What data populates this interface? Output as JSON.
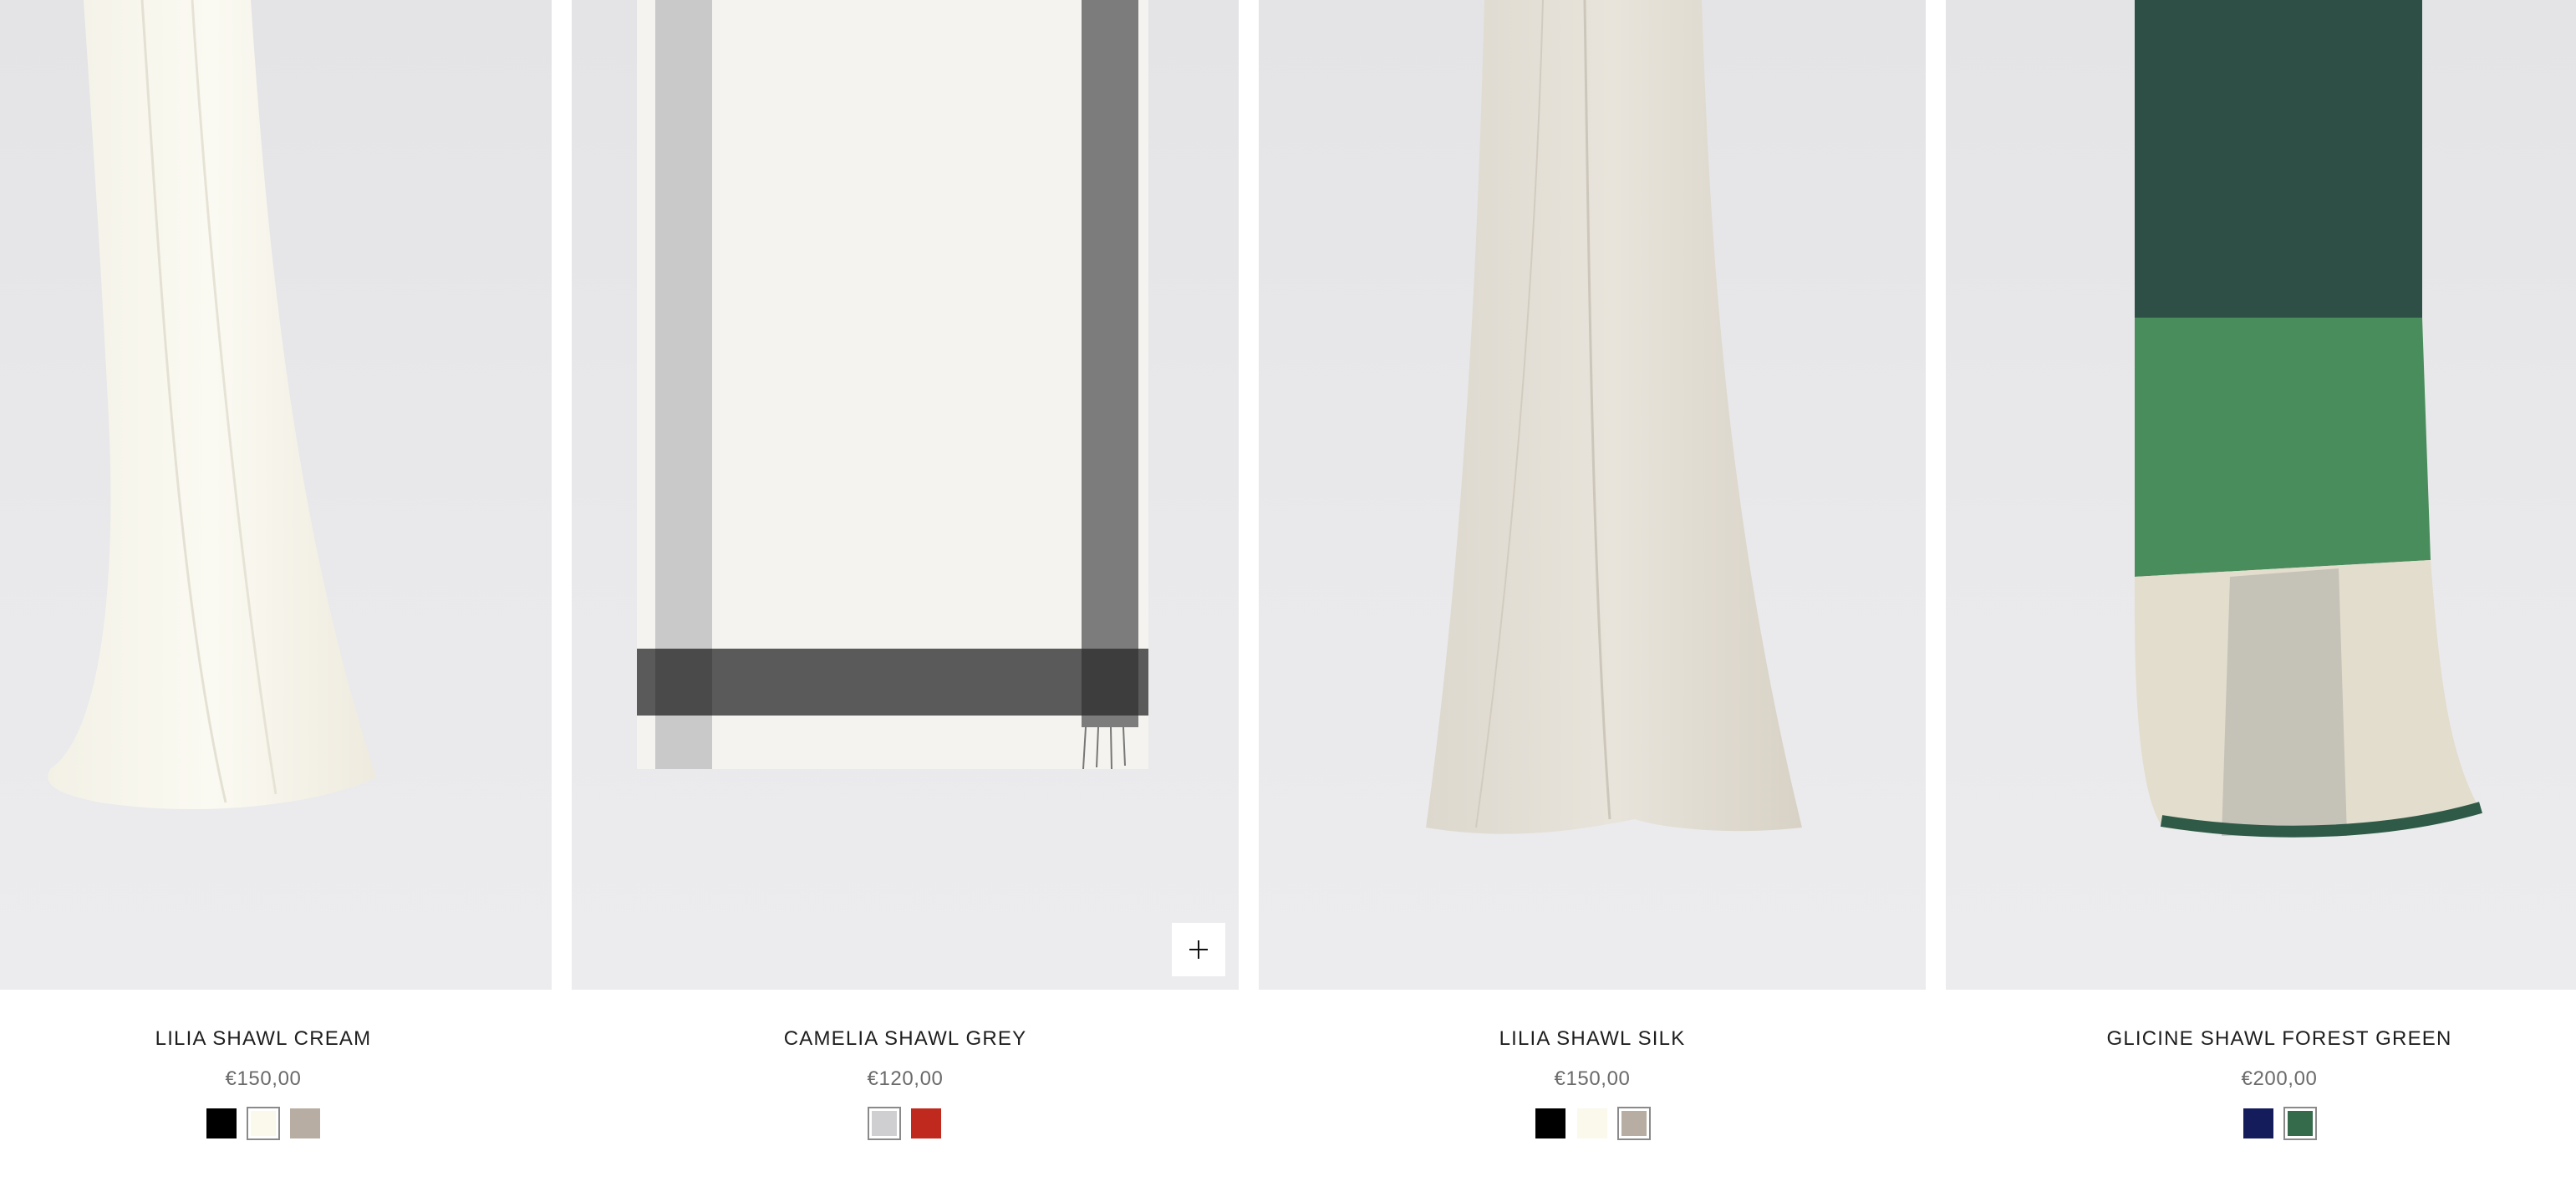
{
  "products": [
    {
      "name": "LILIA SHAWL CREAM",
      "price": "€150,00",
      "swatches": [
        {
          "color": "#000000",
          "selected": false
        },
        {
          "color": "#fbf8ec",
          "selected": true
        },
        {
          "color": "#b7ada2",
          "selected": false
        }
      ]
    },
    {
      "name": "CAMELIA SHAWL GREY",
      "price": "€120,00",
      "swatches": [
        {
          "color": "#cfcfd2",
          "selected": true
        },
        {
          "color": "#c0291e",
          "selected": false
        }
      ],
      "add_icon": "plus-icon"
    },
    {
      "name": "LILIA SHAWL SILK",
      "price": "€150,00",
      "swatches": [
        {
          "color": "#000000",
          "selected": false
        },
        {
          "color": "#fbf8ec",
          "selected": false
        },
        {
          "color": "#b7ada2",
          "selected": true
        }
      ]
    },
    {
      "name": "GLICINE SHAWL FOREST GREEN",
      "price": "€200,00",
      "swatches": [
        {
          "color": "#151c5c",
          "selected": false
        },
        {
          "color": "#356a4a",
          "selected": true
        }
      ]
    }
  ]
}
